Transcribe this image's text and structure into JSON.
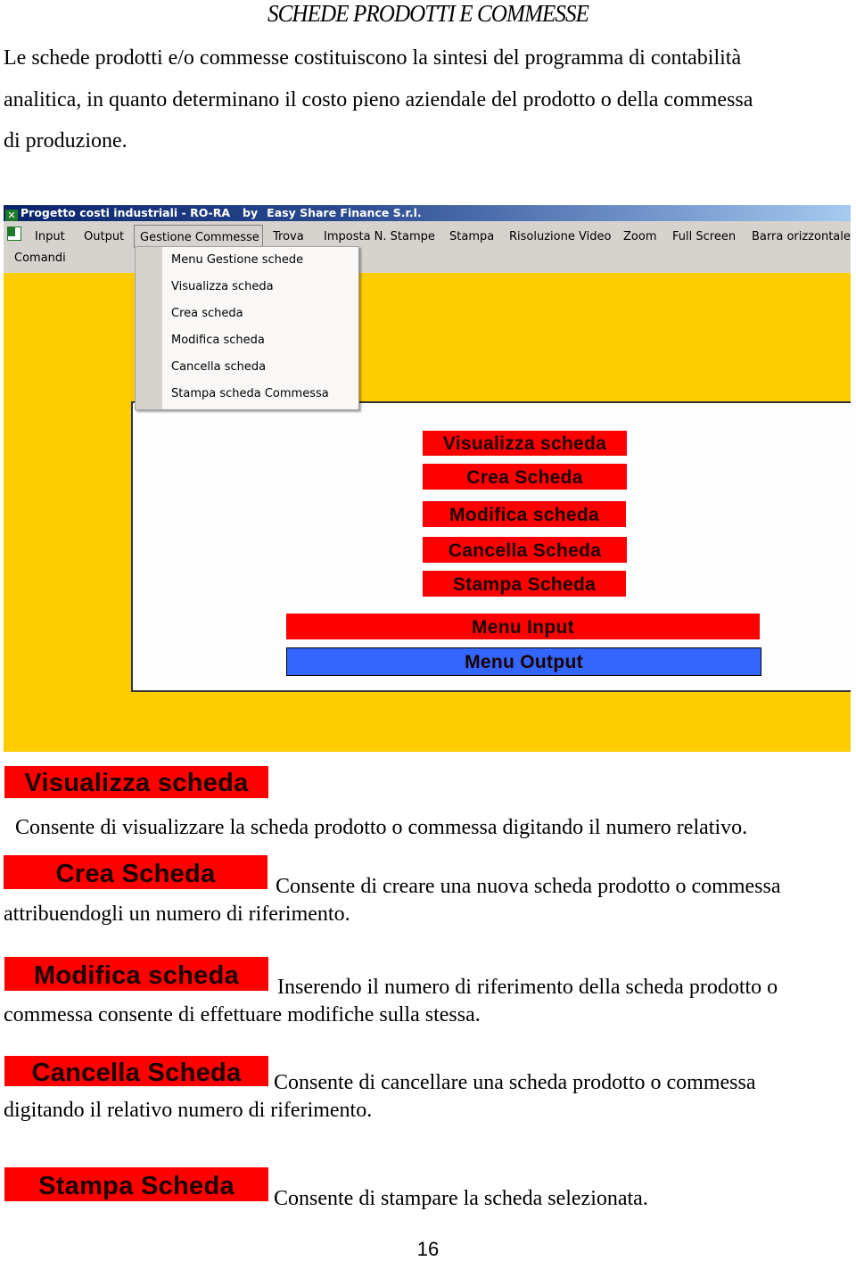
{
  "document": {
    "title": "SCHEDE PRODOTTI E COMMESSE",
    "intro_lines": [
      "Le schede prodotti e/o commesse costituiscono la sintesi del programma di contabilità",
      "analitica, in quanto determinano il costo pieno aziendale del prodotto o della commessa",
      "di produzione."
    ],
    "page_number": "16"
  },
  "app": {
    "window_title": "Progetto costi industriali - RO-RA",
    "window_title_by": "by",
    "window_title_company": "Easy Share Finance S.r.l.",
    "menu": [
      "Input",
      "Output",
      "Gestione Commesse",
      "Trova",
      "Imposta N. Stampe",
      "Stampa",
      "Risoluzione Video",
      "Zoom",
      "Full Screen",
      "Barra orizzontale"
    ],
    "menu_second_row": "Comandi",
    "open_menu": "Gestione Commesse",
    "dropdown_items": [
      "Menu Gestione schede",
      "Visualizza scheda",
      "Crea scheda",
      "Modifica scheda",
      "Cancella scheda",
      "Stampa scheda Commessa"
    ],
    "form_buttons": [
      "Visualizza scheda",
      "Crea Scheda",
      "Modifica scheda",
      "Cancella Scheda",
      "Stampa Scheda"
    ],
    "menu_input_label": "Menu Input",
    "menu_output_label": "Menu Output",
    "colors": {
      "background": "#ffcc00",
      "red_button": "#ff0000",
      "blue_button": "#3366ff",
      "menubar": "#d6d3ce",
      "titlebar": "#0a246a"
    }
  },
  "sections": [
    {
      "button": "Visualizza scheda",
      "text_line1": "Consente di visualizzare la scheda prodotto o commessa digitando il numero relativo.",
      "text_line2": ""
    },
    {
      "button": "Crea Scheda",
      "text_line1": "Consente di creare una nuova scheda prodotto o commessa",
      "text_line2": "attribuendogli un numero di riferimento."
    },
    {
      "button": "Modifica scheda",
      "text_line1": "Inserendo il numero di riferimento della scheda prodotto o",
      "text_line2": "commessa consente di effettuare modifiche sulla stessa."
    },
    {
      "button": "Cancella Scheda",
      "text_line1": "Consente di cancellare una scheda prodotto o commessa",
      "text_line2": "digitando il relativo numero di riferimento."
    },
    {
      "button": "Stampa Scheda",
      "text_line1": "Consente di stampare la scheda selezionata.",
      "text_line2": ""
    }
  ]
}
